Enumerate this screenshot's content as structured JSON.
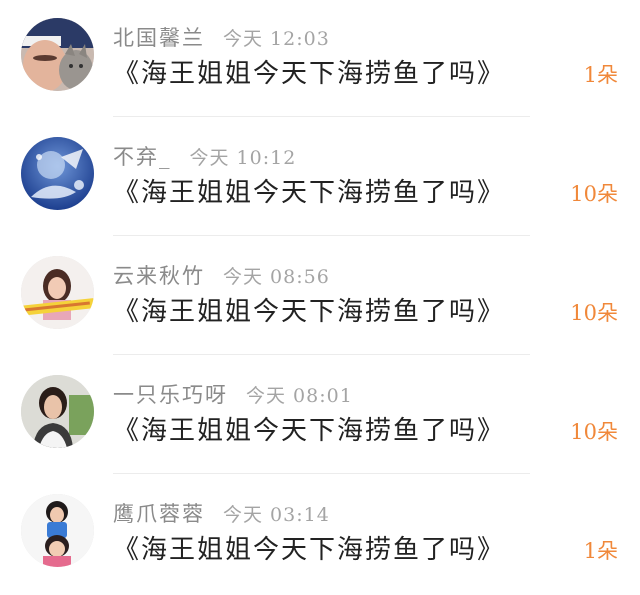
{
  "colors": {
    "name": "#8a8a8a",
    "time": "#a4a4a4",
    "title": "#222222",
    "count": "#f0883a"
  },
  "items": [
    {
      "name": "北国馨兰",
      "time": "今天 12:03",
      "title": "《海王姐姐今天下海捞鱼了吗》",
      "count": "1朵",
      "avatar_icon": "avatar-user-with-cat"
    },
    {
      "name": "不弃_",
      "time": "今天 10:12",
      "title": "《海王姐姐今天下海捞鱼了吗》",
      "count": "10朵",
      "avatar_icon": "avatar-blue-art"
    },
    {
      "name": "云来秋竹",
      "time": "今天 08:56",
      "title": "《海王姐姐今天下海捞鱼了吗》",
      "count": "10朵",
      "avatar_icon": "avatar-woman-with-banner"
    },
    {
      "name": "一只乐巧呀",
      "time": "今天 08:01",
      "title": "《海王姐姐今天下海捞鱼了吗》",
      "count": "10朵",
      "avatar_icon": "avatar-woman-portrait"
    },
    {
      "name": "鹰爪蓉蓉",
      "time": "今天 03:14",
      "title": "《海王姐姐今天下海捞鱼了吗》",
      "count": "1朵",
      "avatar_icon": "avatar-two-children"
    }
  ]
}
